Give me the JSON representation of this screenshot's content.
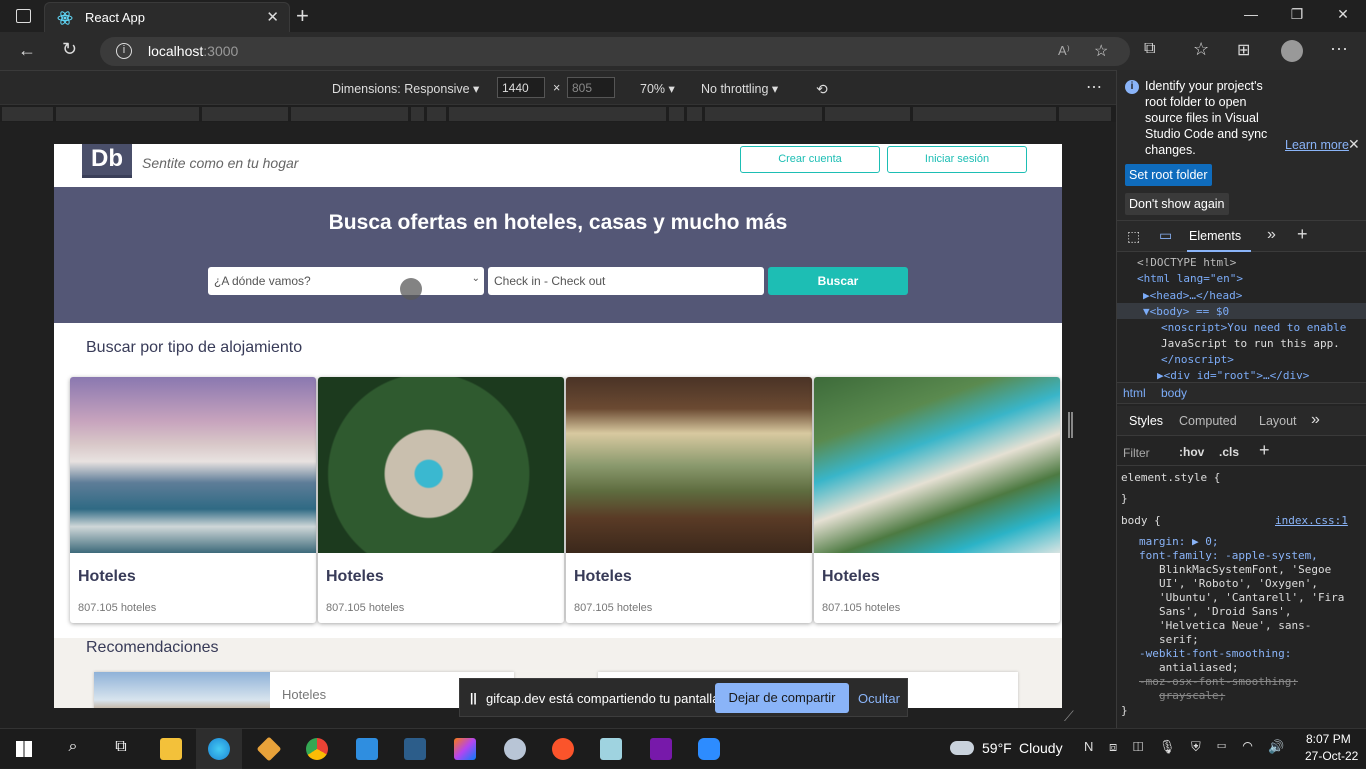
{
  "browser": {
    "tab_title": "React App",
    "close_tab": "✕",
    "new_tab": "+",
    "url_host": "localhost",
    "url_port": ":3000"
  },
  "devtools_toolbar": {
    "dimensions_label": "Dimensions: Responsive",
    "width": "1440",
    "times": "×",
    "height": "805",
    "zoom": "70%",
    "throttling": "No throttling"
  },
  "site": {
    "logo": "Db",
    "tagline": "Sentite como en tu hogar",
    "create_account": "Crear cuenta",
    "login": "Iniciar sesión",
    "hero_title": "Busca ofertas en hoteles, casas y mucho más",
    "destination_placeholder": "¿A dónde vamos?",
    "dates_placeholder": "Check in - Check out",
    "search_button": "Buscar",
    "section_types": "Buscar por tipo de alojamiento",
    "categories": [
      {
        "title": "Hoteles",
        "count": "807.105 hoteles"
      },
      {
        "title": "Hoteles",
        "count": "807.105 hoteles"
      },
      {
        "title": "Hoteles",
        "count": "807.105 hoteles"
      },
      {
        "title": "Hoteles",
        "count": "807.105 hoteles"
      }
    ],
    "section_recs": "Recomendaciones",
    "rec_first_title": "Hoteles"
  },
  "share_bar": {
    "message": "gifcap.dev está compartiendo tu pantalla.",
    "stop": "Dejar de compartir",
    "hide": "Ocultar"
  },
  "devtools": {
    "notice": "Identify your project's root folder to open source files in Visual Studio Code and sync changes.",
    "learn_more": "Learn more",
    "set_root": "Set root folder",
    "dont_show": "Don't show again",
    "elements_tab": "Elements",
    "dom_lines": [
      "<!DOCTYPE html>",
      "<html lang=\"en\">",
      "▶<head>…</head>",
      "▼<body> == $0",
      "<noscript>You need to enable",
      "JavaScript to run this app.",
      "</noscript>",
      "▶<div id=\"root\">…</div>"
    ],
    "crumb_html": "html",
    "crumb_body": "body",
    "styles_tab": "Styles",
    "computed_tab": "Computed",
    "layout_tab": "Layout",
    "filter_placeholder": "Filter",
    "hov": ":hov",
    "cls": ".cls",
    "css_lines": [
      "element.style {",
      "}",
      "body {",
      "margin: ▶ 0;",
      "font-family: -apple-system,",
      "BlinkMacSystemFont, 'Segoe",
      "UI', 'Roboto', 'Oxygen',",
      "'Ubuntu', 'Cantarell', 'Fira",
      "Sans', 'Droid Sans',",
      "'Helvetica Neue', sans-",
      "serif;",
      "-webkit-font-smoothing:",
      "antialiased;",
      "-moz-osx-font-smoothing:",
      "grayscale;",
      "}"
    ],
    "css_source": "index.css:1"
  },
  "taskbar": {
    "temperature": "59°F",
    "weather": "Cloudy",
    "time": "8:07 PM",
    "date": "27-Oct-22"
  }
}
